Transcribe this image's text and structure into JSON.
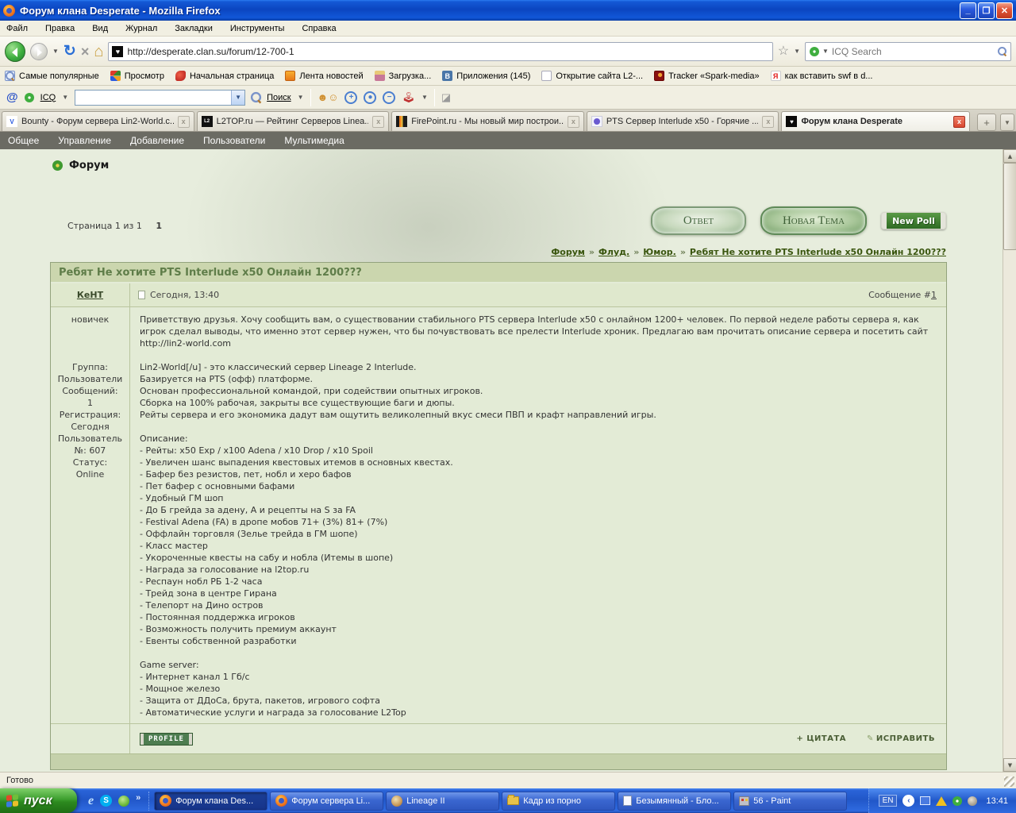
{
  "colors": {
    "xp_blue": "#2157c8",
    "accent_green": "#2f6b24",
    "page_bg": "#e7eddd",
    "link_green": "#39550e",
    "adminbar_bg": "#6b6b63"
  },
  "titlebar": {
    "title": "Форум клана Desperate - Mozilla Firefox",
    "minimize": "_",
    "maximize": "❐",
    "close": "✕"
  },
  "menubar": {
    "items": [
      "Файл",
      "Правка",
      "Вид",
      "Журнал",
      "Закладки",
      "Инструменты",
      "Справка"
    ]
  },
  "navbar": {
    "url": "http://desperate.clan.su/forum/12-700-1",
    "search_placeholder": "ICQ Search"
  },
  "bookmarks": {
    "items": [
      {
        "label": "Самые популярные"
      },
      {
        "label": "Просмотр"
      },
      {
        "label": "Начальная страница"
      },
      {
        "label": "Лента новостей"
      },
      {
        "label": "Загрузка..."
      },
      {
        "label": "Приложения (145)",
        "glyph": "B"
      },
      {
        "label": "Открытие сайта L2-..."
      },
      {
        "label": "Tracker «Spark-media»"
      },
      {
        "label": "как вставить swf в d...",
        "glyph": "Я"
      }
    ]
  },
  "icqbar": {
    "brand": "ICQ",
    "search_button": "Поиск"
  },
  "tabstrip": {
    "tabs": [
      {
        "label": "Bounty - Форум сервера Lin2-World.c...",
        "glyph": "V"
      },
      {
        "label": "L2TOP.ru — Рейтинг Серверов Linea...",
        "glyph": "L2"
      },
      {
        "label": "FirePoint.ru - Мы новый мир построи..."
      },
      {
        "label": "PTS Сервер Interlude x50 - Горячие ..."
      },
      {
        "label": "Форум клана Desperate",
        "glyph": "♥"
      }
    ],
    "close_glyph": "x",
    "new_tab": "+",
    "list_tabs": "▼"
  },
  "adminbar": {
    "items": [
      "Общее",
      "Управление",
      "Добавление",
      "Пользователи",
      "Мультимедиа"
    ]
  },
  "page": {
    "heading": "Форум",
    "pagination": "Страница 1 из 1",
    "current_page": "1",
    "reply_button": "Ответ",
    "new_topic_button": "Новая Тема",
    "new_poll_button": "New Poll",
    "breadcrumb": {
      "sep": "»",
      "items": [
        "Форум",
        "Флуд.",
        "Юмор.",
        "Ребят Не хотите PTS Interlude x50 Онлайн 1200???"
      ]
    },
    "topic_title": "Ребят Не хотите PTS Interlude x50 Онлайн 1200???",
    "post": {
      "author": "КеНТ",
      "date": "Сегодня, 13:40",
      "message_label": "Сообщение #",
      "message_number": "1",
      "rank": "новичек",
      "user_info": [
        "Группа:",
        "Пользователи",
        "Сообщений:",
        "1",
        "Регистрация:",
        "Сегодня",
        "Пользователь",
        "№: 607",
        "Статус:",
        "Online"
      ],
      "body": "Приветствую друзья. Хочу сообщить вам, о существовании стабильного PTS сервера Interlude x50 с онлайном 1200+ человек. По первой неделе работы сервера я, как игрок сделал выводы, что именно этот сервер нужен, что бы почувствовать все прелести Interlude хроник. Предлагаю вам прочитать описание сервера и посетить сайт http://lin2-world.com\n\nLin2-World[/u] - это классический сервер Lineage 2 Interlude.\nБазируется на PTS (офф) платформе.\nОснован профессиональной командой, при содействии опытных игроков.\nСборка на 100% рабочая, закрыты все существующие баги и дюпы.\nРейты сервера и его экономика дадут вам ощутить великолепный вкус смеси ПВП и крафт направлений игры.\n\nОписание:\n- Рейты: x50 Exp / x100 Adena / x10 Drop / x10 Spoil\n- Увеличен шанс выпадения квестовых итемов в основных квестах.\n- Бафер без резистов, пет, нобл и херо бафов\n- Пет бафер с основными бафами\n- Удобный ГМ шоп\n- До Б грейда за адену, А и рецепты на S за FA\n- Festival Adena (FA) в дропе мобов 71+ (3%) 81+ (7%)\n- Оффлайн торговля (Зелье трейда в ГМ шопе)\n- Класс мастер\n- Укороченные квесты на сабу и нобла (Итемы в шопе)\n- Награда за голосование на l2top.ru\n- Респаун нобл РБ 1-2 часа\n- Трейд зона в центре Гирана\n- Телепорт на Дино остров\n- Постоянная поддержка игроков\n- Возможность получить премиум аккаунт\n- Евенты собственной разработки\n\nGame server:\n- Интернет канал 1 Гб/с\n- Мощное железо\n- Защита от ДДоСа, брута, пакетов, игрового софта\n- Автоматические услуги и награда за голосование L2Top",
      "profile_button": "PROFILE",
      "quote_button": "+ ЦИТАТА",
      "edit_button": "ИСПРАВИТЬ"
    }
  },
  "statusbar": {
    "text": "Готово"
  },
  "taskbar": {
    "start": "пуск",
    "overflow": "»",
    "quicklaunch": {
      "ie_glyph": "e",
      "skype_glyph": "S"
    },
    "tasks": [
      "Форум клана Des...",
      "Форум сервера Li...",
      "Lineage II",
      "Кадр из порно",
      "Безымянный - Бло...",
      "56 - Paint"
    ],
    "tray": {
      "lang": "EN",
      "chevron": "‹",
      "time": "13:41"
    }
  }
}
